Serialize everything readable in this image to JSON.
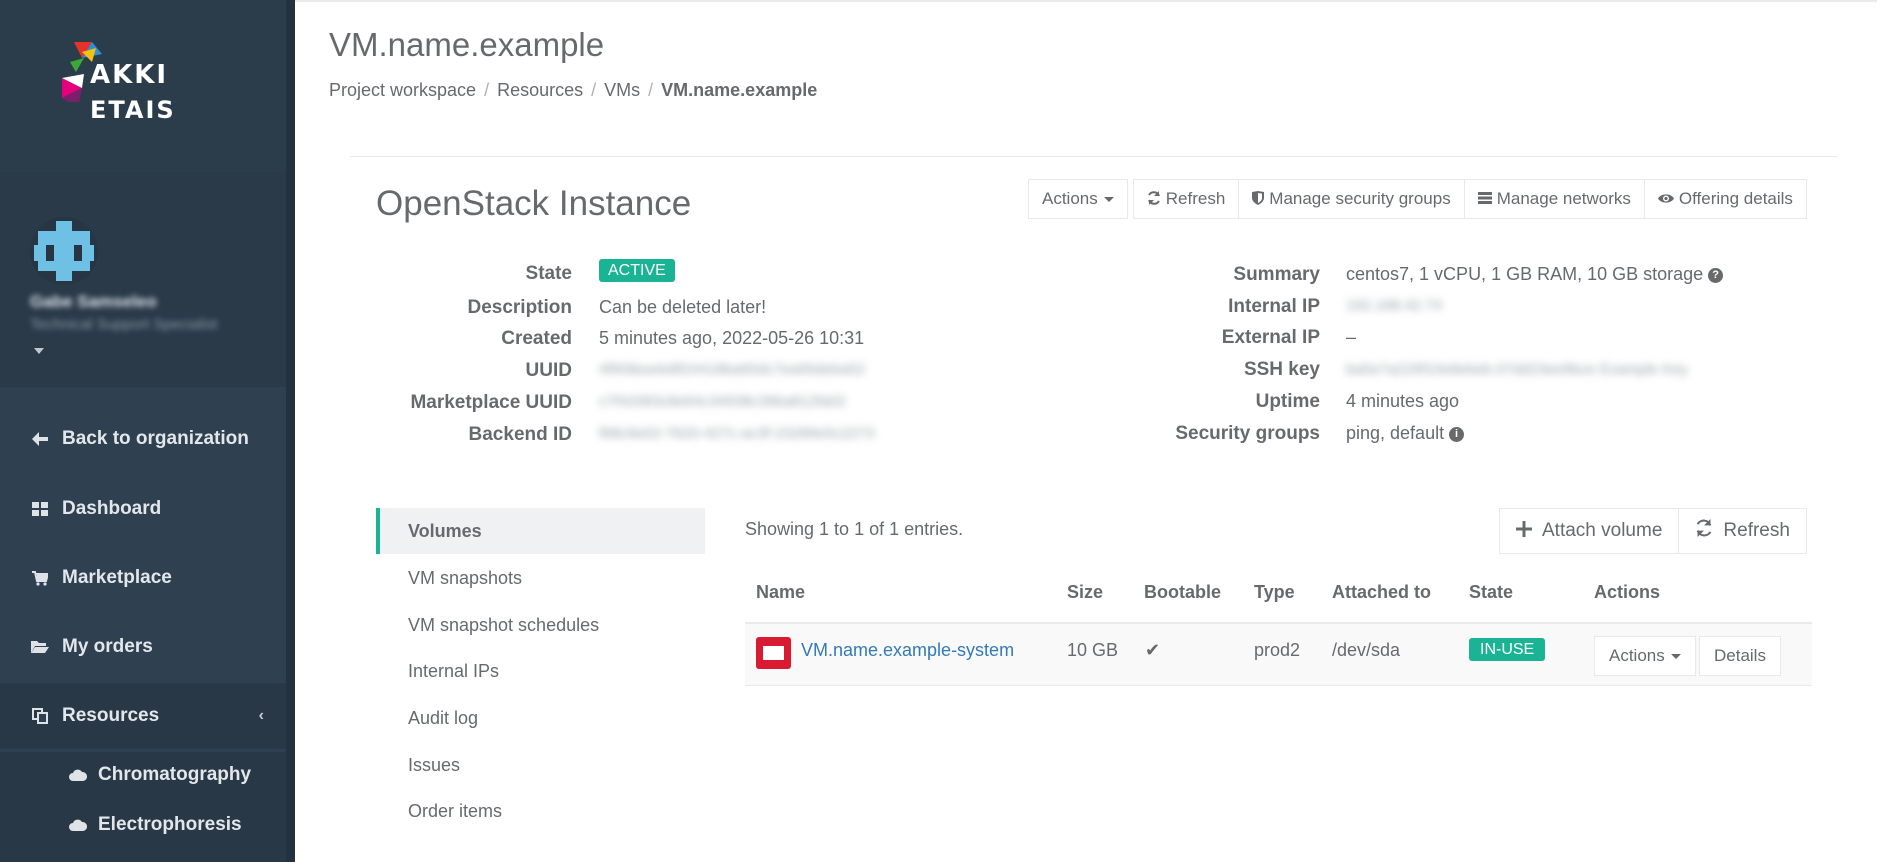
{
  "brand": {
    "logo_line1": "AKKI",
    "logo_line2": "ETAIS",
    "colors": {
      "sidebar": "#2f4050",
      "accent": "#1ab394",
      "link": "#337ab7"
    }
  },
  "profile": {
    "name": "Gabe Samseleo",
    "role": "Technical Support Specialist"
  },
  "sidebar": {
    "items": [
      {
        "label": "Back to organization",
        "icon": "arrow-left-icon"
      },
      {
        "label": "Dashboard",
        "icon": "grid-icon"
      },
      {
        "label": "Marketplace",
        "icon": "cart-icon"
      },
      {
        "label": "My orders",
        "icon": "folder-open-icon"
      },
      {
        "label": "Resources",
        "icon": "copy-icon"
      }
    ],
    "sub_items": [
      {
        "label": "Chromatography",
        "icon": "cloud-icon"
      },
      {
        "label": "Electrophoresis",
        "icon": "cloud-icon"
      }
    ]
  },
  "header": {
    "title": "VM.name.example",
    "breadcrumb": [
      "Project workspace",
      "Resources",
      "VMs",
      "VM.name.example"
    ]
  },
  "instance": {
    "title": "OpenStack Instance",
    "buttons": {
      "actions": "Actions",
      "refresh": "Refresh",
      "security_groups": "Manage security groups",
      "networks": "Manage networks",
      "offering": "Offering details"
    },
    "left": {
      "state_label": "State",
      "state_value": "ACTIVE",
      "description_label": "Description",
      "description_value": "Can be deleted later!",
      "created_label": "Created",
      "created_value": "5 minutes ago, 2022-05-26 10:31",
      "uuid_label": "UUID",
      "uuid_value": "4f908ea4e8f24418ba65dc7ea95deba52",
      "marketplace_uuid_label": "Marketplace UUID",
      "marketplace_uuid_value": "c7f42083c8e64c34938c39ba812fa02",
      "backend_id_label": "Backend ID",
      "backend_id_value": "f68c6e02-7620-427c-ac3f-23289e5c2273"
    },
    "right": {
      "summary_label": "Summary",
      "summary_value": "centos7, 1 vCPU, 1 GB RAM, 10 GB storage",
      "internal_ip_label": "Internal IP",
      "internal_ip_value": "192.168.42.74",
      "external_ip_label": "External IP",
      "external_ip_value": "–",
      "ssh_key_label": "SSH key",
      "ssh_key_value": "ba5e7a229f10e8ebeb.07dd23ee9bce Example Key",
      "uptime_label": "Uptime",
      "uptime_value": "4 minutes ago",
      "security_groups_label": "Security groups",
      "security_groups_value": "ping, default"
    }
  },
  "tabs": [
    "Volumes",
    "VM snapshots",
    "VM snapshot schedules",
    "Internal IPs",
    "Audit log",
    "Issues",
    "Order items"
  ],
  "volumes": {
    "showing": "Showing 1 to 1 of 1 entries.",
    "attach_label": "Attach volume",
    "refresh_label": "Refresh",
    "columns": [
      "Name",
      "Size",
      "Bootable",
      "Type",
      "Attached to",
      "State",
      "Actions"
    ],
    "rows": [
      {
        "name": "VM.name.example-system",
        "size": "10 GB",
        "bootable": "✔",
        "type": "prod2",
        "attached_to": "/dev/sda",
        "state": "IN-USE",
        "actions_label": "Actions",
        "details_label": "Details"
      }
    ]
  }
}
